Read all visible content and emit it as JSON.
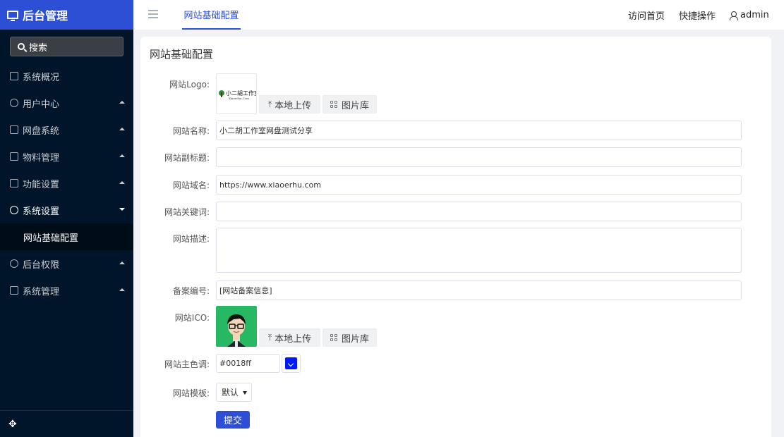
{
  "app": {
    "title": "后台管理"
  },
  "search": {
    "label": "搜索"
  },
  "sidebar": {
    "items": [
      {
        "label": "系统概况",
        "icon": "home-icon"
      },
      {
        "label": "用户中心",
        "icon": "users-icon"
      },
      {
        "label": "网盘系统",
        "icon": "folder-icon"
      },
      {
        "label": "物料管理",
        "icon": "document-icon"
      },
      {
        "label": "功能设置",
        "icon": "tools-icon"
      },
      {
        "label": "系统设置",
        "icon": "gear-icon"
      },
      {
        "label": "后台权限",
        "icon": "user-circle-icon"
      },
      {
        "label": "系统管理",
        "icon": "monitor-icon"
      }
    ],
    "submenu": {
      "label": "网站基础配置"
    }
  },
  "header": {
    "tab": "网站基础配置",
    "links": {
      "home": "访问首页",
      "quick": "快捷操作",
      "user": "admin"
    }
  },
  "form": {
    "title": "网站基础配置",
    "logo_label": "网站Logo:",
    "upload_label": "本地上传",
    "gallery_label": "图片库",
    "name_label": "网站名称:",
    "name_value": "小二胡工作室网盘测试分享",
    "subtitle_label": "网站副标题:",
    "subtitle_value": "",
    "domain_label": "网站域名:",
    "domain_value": "https://www.xiaoerhu.com",
    "keywords_label": "网站关键词:",
    "keywords_value": "",
    "desc_label": "网站描述:",
    "desc_value": "",
    "icp_label": "备案编号:",
    "icp_value": "[网站备案信息]",
    "ico_label": "网站ICO:",
    "color_label": "网站主色调:",
    "color_value": "#0018ff",
    "template_label": "网站模板:",
    "template_value": "默认",
    "submit_label": "提交"
  },
  "logo": {
    "text": "小二胡工作室",
    "subtext": "Xiaoerhu.Com"
  },
  "colors": {
    "brand": "#2d4fd6",
    "sidebar_bg": "#001529",
    "main_color": "#0018ff",
    "ico_bg": "#27b864"
  }
}
